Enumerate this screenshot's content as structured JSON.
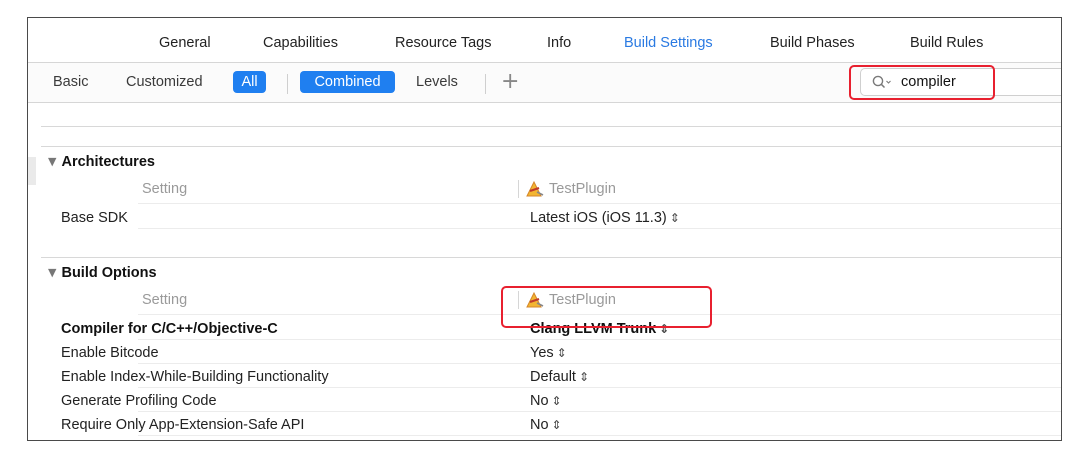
{
  "tabs": [
    {
      "label": "General",
      "active": false
    },
    {
      "label": "Capabilities",
      "active": false
    },
    {
      "label": "Resource Tags",
      "active": false
    },
    {
      "label": "Info",
      "active": false
    },
    {
      "label": "Build Settings",
      "active": true
    },
    {
      "label": "Build Phases",
      "active": false
    },
    {
      "label": "Build Rules",
      "active": false
    }
  ],
  "filter": {
    "basic": "Basic",
    "customized": "Customized",
    "all": "All",
    "combined": "Combined",
    "levels": "Levels",
    "add": "+"
  },
  "search": {
    "value": "compiler",
    "icon": "magnifier-with-dropdown-icon"
  },
  "sections": [
    {
      "title": "Architectures",
      "setting_header": "Setting",
      "target_header": "TestPlugin",
      "rows": [
        {
          "name": "Base SDK",
          "value": "Latest iOS (iOS 11.3)",
          "stepper": "⌃⌄",
          "bold": false
        }
      ]
    },
    {
      "title": "Build Options",
      "setting_header": "Setting",
      "target_header": "TestPlugin",
      "rows": [
        {
          "name": "Compiler for C/C++/Objective-C",
          "value": "Clang LLVM Trunk",
          "bold": true
        },
        {
          "name": "Enable Bitcode",
          "value": "Yes",
          "bold": false
        },
        {
          "name": "Enable Index-While-Building Functionality",
          "value": "Default",
          "bold": false
        },
        {
          "name": "Generate Profiling Code",
          "value": "No",
          "bold": false
        },
        {
          "name": "Require Only App-Extension-Safe API",
          "value": "No",
          "bold": false
        }
      ]
    }
  ],
  "colors": {
    "accent": "#2a7ae2",
    "pill": "#1f7ff0",
    "highlight_box": "#e8202f"
  }
}
